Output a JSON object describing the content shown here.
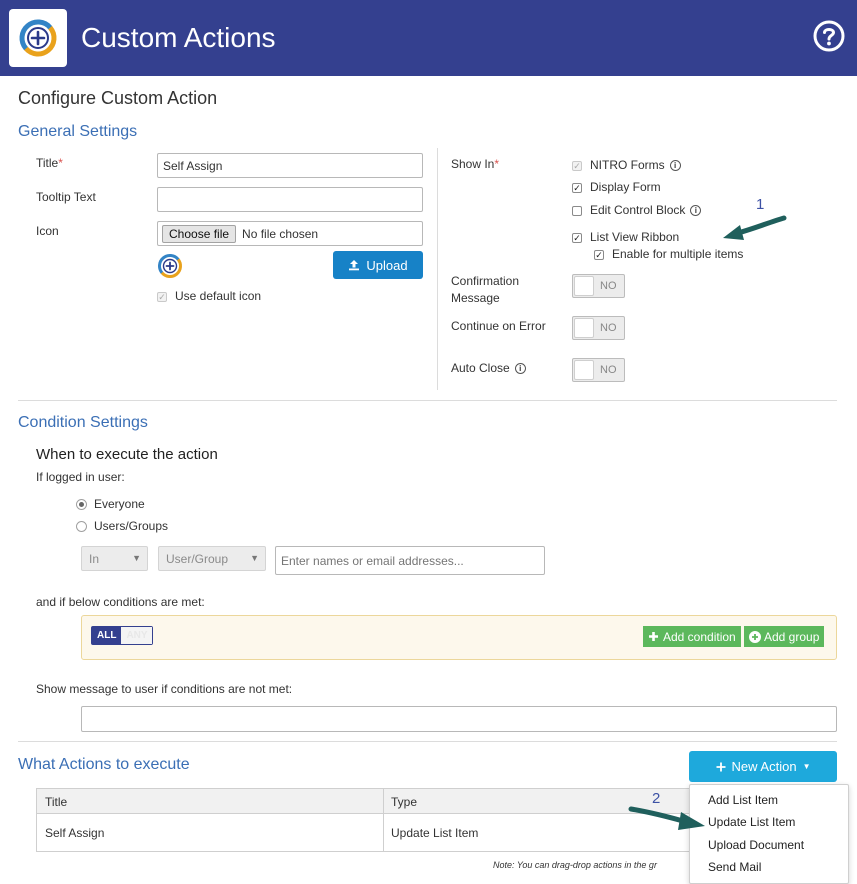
{
  "header": {
    "title": "Custom Actions"
  },
  "page_title": "Configure Custom Action",
  "general": {
    "title": "General Settings",
    "title_label": "Title",
    "required_mark": "*",
    "title_value": "Self Assign",
    "tooltip_label": "Tooltip Text",
    "tooltip_value": "",
    "icon_label": "Icon",
    "choose_file": "Choose file",
    "no_file": "No file chosen",
    "upload": "Upload",
    "use_default_icon": "Use default icon"
  },
  "show_in": {
    "label": "Show In",
    "nitro_forms": "NITRO Forms",
    "display_form": "Display Form",
    "edit_control_block": "Edit Control Block",
    "list_view_ribbon": "List View Ribbon",
    "enable_multiple": "Enable for multiple items",
    "confirmation_line1": "Confirmation",
    "confirmation_line2": "Message",
    "continue_on_error": "Continue on Error",
    "auto_close": "Auto Close",
    "toggle_off": "NO",
    "info": "i"
  },
  "conditions": {
    "title": "Condition Settings",
    "when": "When to execute the action",
    "if_logged": "If logged in user:",
    "everyone": "Everyone",
    "users_groups": "Users/Groups",
    "in": "In",
    "user_group": "User/Group",
    "names_placeholder": "Enter names or email addresses...",
    "if_below": "and if below conditions are met:",
    "all": "ALL",
    "any": "ANY",
    "add_condition": "Add condition",
    "add_group": "Add group",
    "show_message": "Show message to user if conditions are not met:",
    "message_value": ""
  },
  "actions": {
    "title": "What Actions to execute",
    "new_action": "New Action",
    "col_title": "Title",
    "col_type": "Type",
    "rows": [
      {
        "title": "Self Assign",
        "type": "Update List Item"
      }
    ],
    "note": "Note: You can drag-drop actions in the gr",
    "menu": [
      "Add List Item",
      "Update List Item",
      "Upload Document",
      "Send Mail"
    ]
  },
  "annotations": [
    "1",
    "2"
  ],
  "colors": {
    "header": "#34408f",
    "section": "#3b6fb5",
    "primary": "#1782c7",
    "new_action": "#1ea9dc",
    "green": "#5cb85c",
    "arrow": "#1f5f5c"
  },
  "icons": [
    "app-logo-icon",
    "help-icon",
    "upload-icon",
    "default-action-icon",
    "info-icon",
    "plus-icon",
    "plus-circle-icon",
    "caret-down-icon"
  ]
}
